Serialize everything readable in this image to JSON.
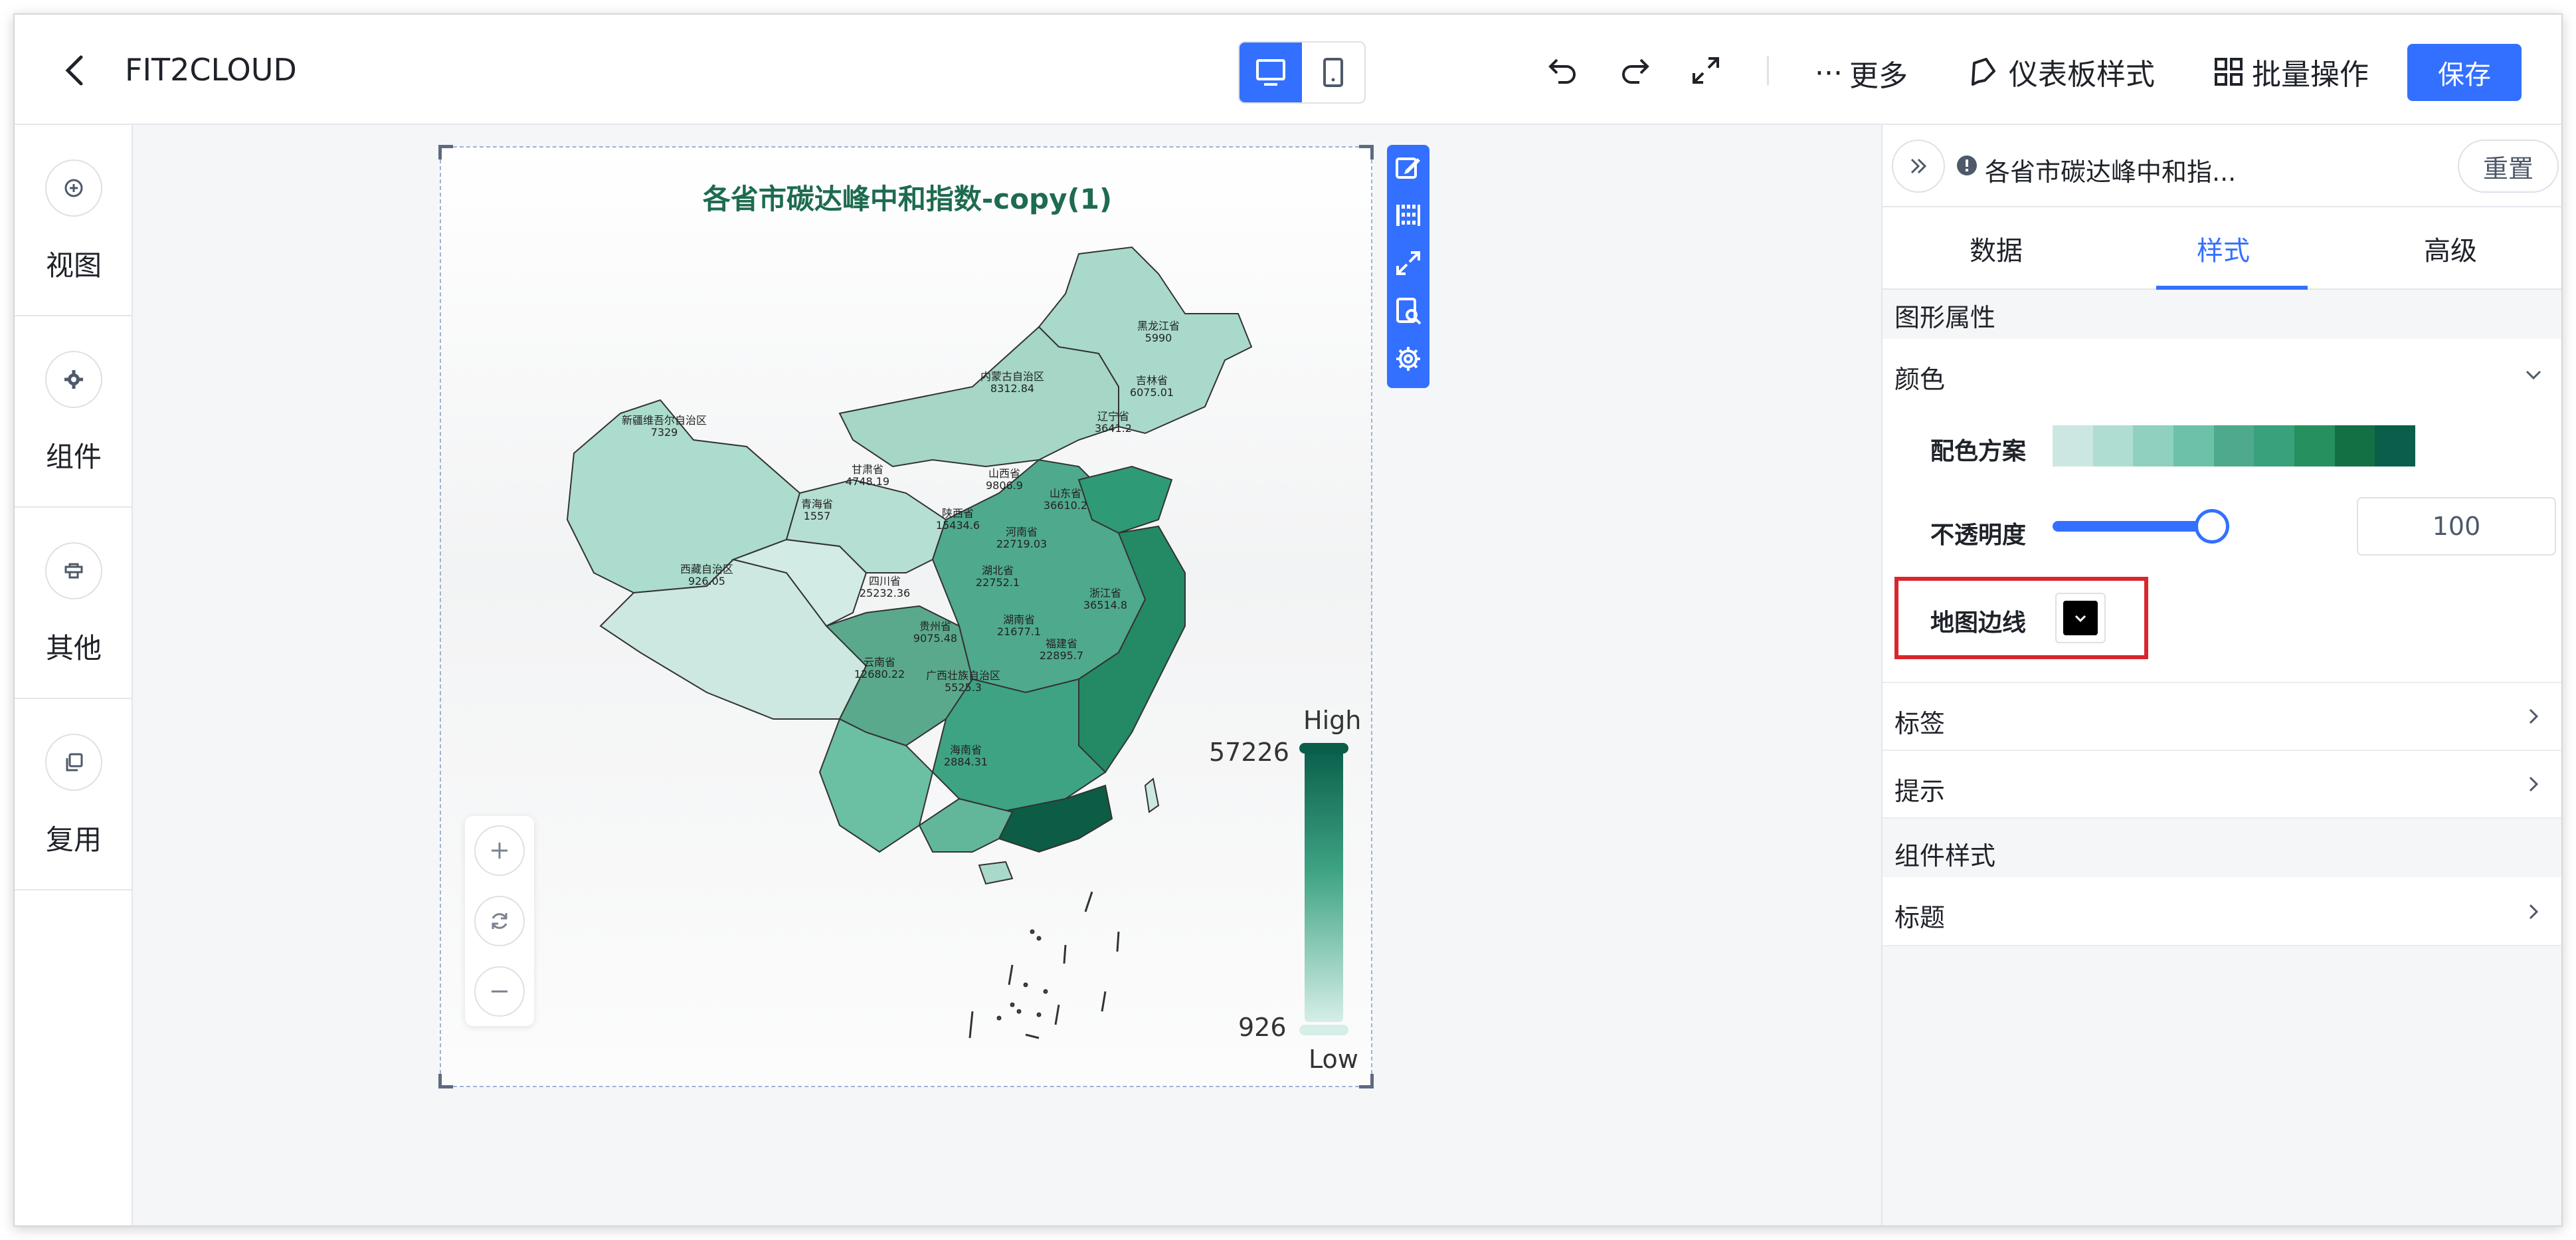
{
  "header": {
    "app_title": "FIT2CLOUD",
    "more_label": "更多",
    "dashboard_style_label": "仪表板样式",
    "batch_label": "批量操作",
    "save_label": "保存"
  },
  "leftnav": {
    "items": [
      {
        "label": "视图",
        "icon": "plus-circle-icon"
      },
      {
        "label": "组件",
        "icon": "gear-icon"
      },
      {
        "label": "其他",
        "icon": "stamp-icon"
      },
      {
        "label": "复用",
        "icon": "copy-icon"
      }
    ]
  },
  "chart": {
    "title": "各省市碳达峰中和指数-copy(1)",
    "legend": {
      "high_label": "High",
      "low_label": "Low",
      "max_value": "57226",
      "min_value": "926"
    },
    "map_labels": [
      {
        "name": "黑龙江省",
        "value": "5990"
      },
      {
        "name": "吉林省",
        "value": "6075.01"
      },
      {
        "name": "辽宁省",
        "value": "3641.2"
      },
      {
        "name": "内蒙古自治区",
        "value": "8312.84"
      },
      {
        "name": "新疆维吾尔自治区",
        "value": "7329"
      },
      {
        "name": "甘肃省",
        "value": "4748.19"
      },
      {
        "name": "青海省",
        "value": "1557"
      },
      {
        "name": "西藏自治区",
        "value": "926.05"
      },
      {
        "name": "山西省",
        "value": "9806.9"
      },
      {
        "name": "陕西省",
        "value": "15434.6"
      },
      {
        "name": "山东省",
        "value": "36610.2"
      },
      {
        "name": "河南省",
        "value": "22719.03"
      },
      {
        "name": "湖北省",
        "value": "22752.1"
      },
      {
        "name": "四川省",
        "value": "25232.36"
      },
      {
        "name": "贵州省",
        "value": "9075.48"
      },
      {
        "name": "湖南省",
        "value": "21677.1"
      },
      {
        "name": "云南省",
        "value": "12680.22"
      },
      {
        "name": "广西壮族自治区",
        "value": "5525.3"
      },
      {
        "name": "福建省",
        "value": "22895.7"
      },
      {
        "name": "海南省",
        "value": "2884.31"
      },
      {
        "name": "浙江省",
        "value": "36514.8"
      }
    ]
  },
  "zoom": {
    "zoom_in": "+",
    "zoom_out": "−"
  },
  "panel": {
    "component_name": "各省市碳达峰中和指...",
    "reset_label": "重置",
    "tabs": [
      {
        "label": "数据",
        "active": false
      },
      {
        "label": "样式",
        "active": true
      },
      {
        "label": "高级",
        "active": false
      }
    ],
    "section_graphic": "图形属性",
    "color_group": "颜色",
    "scheme_label": "配色方案",
    "scheme_colors": [
      "#cce7e1",
      "#b0ddd2",
      "#8fd0bf",
      "#6cc2a9",
      "#4fa98d",
      "#37a27c",
      "#26905f",
      "#137045",
      "#0a5e4a"
    ],
    "opacity_label": "不透明度",
    "opacity_value": "100",
    "opacity_level": 1.0,
    "border_label": "地图边线",
    "border_color": "#000000",
    "label_group": "标签",
    "tooltip_group": "提示",
    "section_component": "组件样式",
    "title_group": "标题"
  }
}
